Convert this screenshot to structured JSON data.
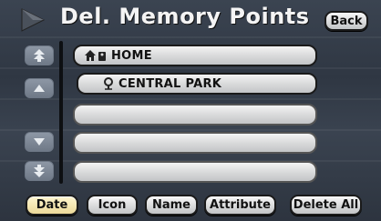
{
  "header": {
    "title": "Del. Memory Points",
    "back_label": "Back"
  },
  "side_controls": [
    {
      "name": "page-up-button",
      "icon": "double-up-arrow-icon"
    },
    {
      "name": "scroll-up-button",
      "icon": "up-arrow-icon"
    },
    {
      "name": "scroll-down-button",
      "icon": "down-arrow-icon"
    },
    {
      "name": "page-down-button",
      "icon": "double-down-arrow-icon"
    }
  ],
  "list": {
    "items": [
      {
        "label": "HOME",
        "icon": "home-icon"
      },
      {
        "label": "CENTRAL PARK",
        "icon": "park-icon"
      },
      {
        "label": ""
      },
      {
        "label": ""
      },
      {
        "label": ""
      }
    ]
  },
  "footer": {
    "date_label": "Date",
    "icon_label": "Icon",
    "name_label": "Name",
    "attribute_label": "Attribute",
    "delete_all_label": "Delete All",
    "active_sort": "Date"
  },
  "colors": {
    "active_sort_bg": "#ecd99a",
    "background": "#2f3743"
  }
}
